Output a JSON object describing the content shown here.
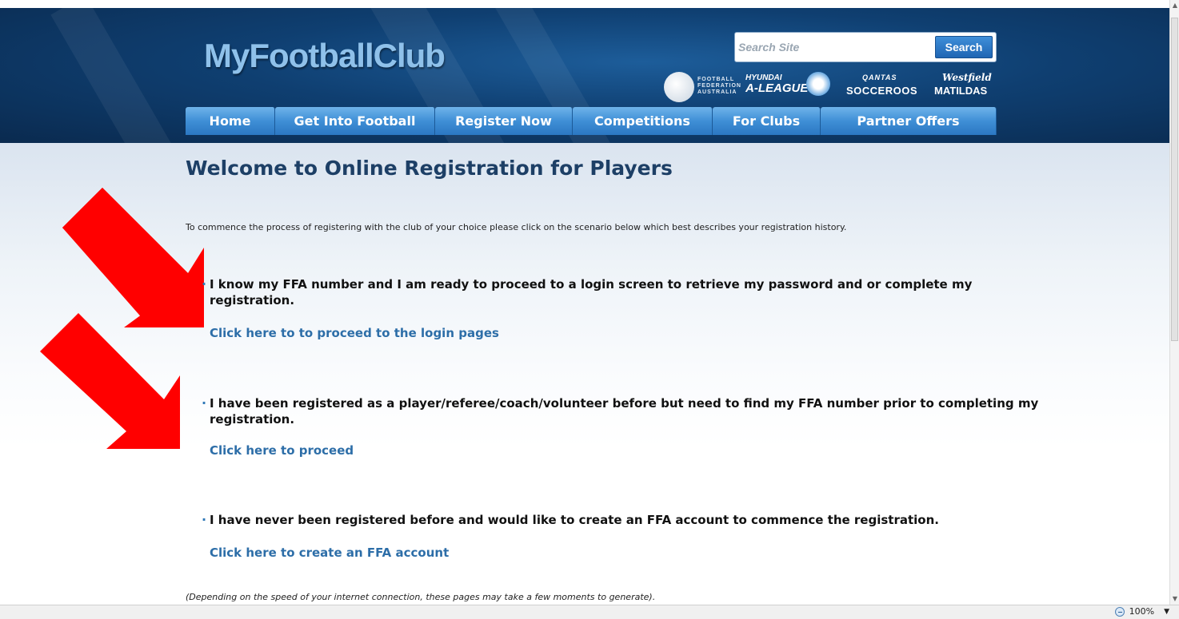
{
  "site": {
    "logo_text": "MyFootballClub"
  },
  "search": {
    "placeholder": "Search Site",
    "button_label": "Search"
  },
  "partners": {
    "ffa_text": "FOOTBALL FEDERATION AUSTRALIA",
    "aleague_line1": "HYUNDAI",
    "aleague_line2": "A-LEAGUE",
    "socceroos_line1": "QANTAS",
    "socceroos_line2": "SOCCEROOS",
    "matildas_line1": "Westfield",
    "matildas_line2": "MATILDAS"
  },
  "nav": {
    "items": [
      {
        "label": "Home"
      },
      {
        "label": "Get Into Football"
      },
      {
        "label": "Register Now"
      },
      {
        "label": "Competitions"
      },
      {
        "label": "For Clubs"
      },
      {
        "label": "Partner Offers"
      }
    ]
  },
  "main": {
    "title": "Welcome to Online Registration for Players",
    "intro": "To commence the process of registering with the club of your choice please click on the scenario below which best describes your registration history.",
    "scenarios": [
      {
        "text": "I know my FFA number and I am ready to proceed to a login screen to retrieve my password and or complete my registration.",
        "link": "Click here to to proceed to the login pages"
      },
      {
        "text": "I have been registered as a player/referee/coach/volunteer before but need to find my FFA number prior to completing my registration.",
        "link": "Click here to proceed"
      },
      {
        "text": "I have never been registered before and would like to create an FFA account to commence the registration.",
        "link": "Click here to create an FFA account"
      }
    ],
    "footnote": "(Depending on the speed of your internet connection, these pages may take a few moments to generate)."
  },
  "statusbar": {
    "zoom_level": "100%"
  },
  "colors": {
    "header_dark": "#0a2a4f",
    "nav_blue": "#3f8fd6",
    "title_navy": "#1d3f66",
    "link_blue": "#2d6ea8",
    "arrow_red": "#ff0000"
  }
}
